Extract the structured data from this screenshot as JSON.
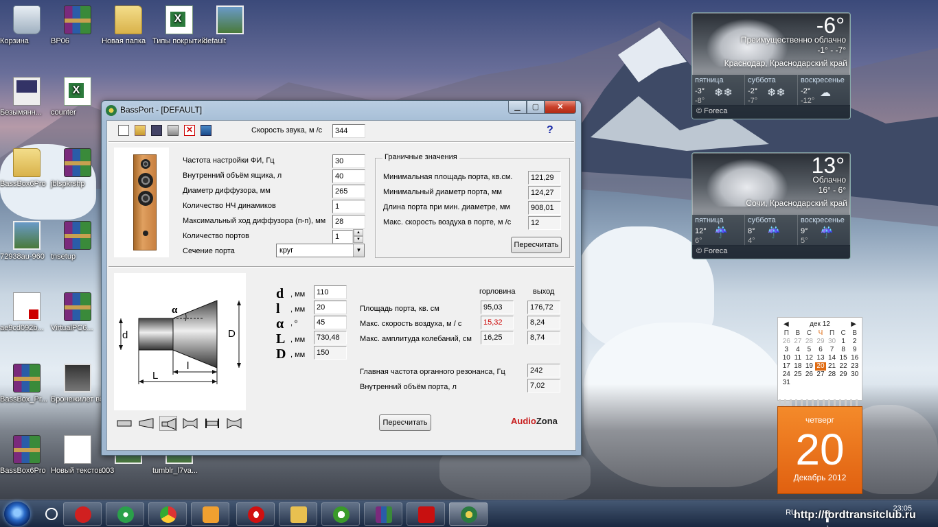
{
  "desktop": {
    "icons": [
      {
        "label": "Корзина",
        "icon": "recycle-bin-icon"
      },
      {
        "label": "BP06",
        "icon": "winrar-archive-icon"
      },
      {
        "label": "Новая папка",
        "icon": "folder-icon"
      },
      {
        "label": "Типы покрытий",
        "icon": "excel-file-icon"
      },
      {
        "label": "default",
        "icon": "image-file-icon"
      },
      {
        "label": "Безымянн...",
        "icon": "paint-image-icon"
      },
      {
        "label": "counter",
        "icon": "excel-file-icon"
      },
      {
        "label": "BassBox6Pro",
        "icon": "folder-icon"
      },
      {
        "label": "jblspkrshp",
        "icon": "winrar-archive-icon"
      },
      {
        "label": "72938au-960",
        "icon": "image-file-icon"
      },
      {
        "label": "tnsetup",
        "icon": "winrar-archive-icon"
      },
      {
        "label": "ae9cd092b...",
        "icon": "pdf-file-icon"
      },
      {
        "label": "VirtualPC6...",
        "icon": "winrar-archive-icon"
      },
      {
        "label": "BassBox_Pr...",
        "icon": "winrar-archive-icon"
      },
      {
        "label": "Бронежилет водителя 8...",
        "icon": "video-file-icon"
      },
      {
        "label": "BassBox6Pro",
        "icon": "winrar-archive-icon"
      },
      {
        "label": "Новый текстов...",
        "icon": "text-file-icon"
      },
      {
        "label": "003",
        "icon": "image-file-icon"
      },
      {
        "label": "tumblr_l7va...",
        "icon": "image-file-icon"
      }
    ]
  },
  "weather1": {
    "temp": "-6°",
    "desc": "Преимущественно облачно",
    "range": "-1° - -7°",
    "city": "Краснодар, Краснодарский край",
    "days": [
      {
        "name": "пятница",
        "hi": "-3°",
        "lo": "-8°"
      },
      {
        "name": "суббота",
        "hi": "-2°",
        "lo": "-7°"
      },
      {
        "name": "воскресенье",
        "hi": "-2°",
        "lo": "-12°"
      }
    ],
    "provider": "© Foreca"
  },
  "weather2": {
    "temp": "13°",
    "desc": "Облачно",
    "range": "16° - 6°",
    "city": "Сочи, Краснодарский край",
    "days": [
      {
        "name": "пятница",
        "hi": "12°",
        "lo": "6°"
      },
      {
        "name": "суббота",
        "hi": "8°",
        "lo": "4°"
      },
      {
        "name": "воскресенье",
        "hi": "9°",
        "lo": "5°"
      }
    ],
    "provider": "© Foreca"
  },
  "calendar": {
    "month": "дек 12",
    "weekdays": [
      "П",
      "В",
      "С",
      "Ч",
      "П",
      "С",
      "В"
    ],
    "rows": [
      [
        "26",
        "27",
        "28",
        "29",
        "30",
        "1",
        "2"
      ],
      [
        "3",
        "4",
        "5",
        "6",
        "7",
        "8",
        "9"
      ],
      [
        "10",
        "11",
        "12",
        "13",
        "14",
        "15",
        "16"
      ],
      [
        "17",
        "18",
        "19",
        "20",
        "21",
        "22",
        "23"
      ],
      [
        "24",
        "25",
        "26",
        "27",
        "28",
        "29",
        "30"
      ],
      [
        "31",
        "",
        "",
        "",
        "",
        "",
        ""
      ]
    ],
    "day_of_week": "четверг",
    "day": "20",
    "month_year": "Декабрь 2012"
  },
  "window": {
    "title": "BassPort - [DEFAULT]",
    "speed_label": "Скорость звука, м /с",
    "speed_value": "344",
    "help": "?",
    "params": [
      {
        "label": "Частота настройки ФИ, Гц",
        "value": "30"
      },
      {
        "label": "Внутренний объём ящика, л",
        "value": "40"
      },
      {
        "label": "Диаметр диффузора, мм",
        "value": "265"
      },
      {
        "label": "Количество НЧ динамиков",
        "value": "1"
      },
      {
        "label": "Максимальный ход диффузора (п-п), мм",
        "value": "28"
      },
      {
        "label": "Количество портов",
        "value": "1"
      }
    ],
    "section_label": "Сечение порта",
    "section_value": "круг",
    "limits": {
      "title": "Граничные значения",
      "rows": [
        {
          "label": "Минимальная площадь порта, кв.см.",
          "value": "121,29"
        },
        {
          "label": "Минимальный диаметр порта, мм",
          "value": "124,27"
        },
        {
          "label": "Длина порта при мин. диаметре, мм",
          "value": "908,01"
        },
        {
          "label": "Макс. скорость воздуха в порте, м /с",
          "value": "12"
        }
      ],
      "button": "Пересчитать"
    },
    "dims": [
      {
        "sym": "d",
        "unit": ", мм",
        "value": "110"
      },
      {
        "sym": "l",
        "unit": ", мм",
        "value": "20"
      },
      {
        "sym": "α",
        "unit": ", º",
        "value": "45"
      },
      {
        "sym": "L",
        "unit": ", мм",
        "value": "730,48"
      },
      {
        "sym": "D",
        "unit": ", мм",
        "value": "150"
      }
    ],
    "results": {
      "col_throat": "горловина",
      "col_exit": "выход",
      "rows": [
        {
          "label": "Площадь порта, кв. см",
          "throat": "95,03",
          "exit": "176,72"
        },
        {
          "label": "Макс. скорость воздуха, м / с",
          "throat": "15,32",
          "exit": "8,24"
        },
        {
          "label": "Макс. амплитуда колебаний, см",
          "throat": "16,25",
          "exit": "8,74"
        }
      ],
      "organ_label": "Главная частота органного резонанса, Гц",
      "organ_value": "242",
      "volume_label": "Внутренний объём порта, л",
      "volume_value": "7,02"
    },
    "diagram_labels": {
      "alpha": "α",
      "d": "d",
      "D": "D",
      "L": "L",
      "l": "l"
    },
    "recalc_button": "Пересчитать",
    "logo_a": "Audio",
    "logo_b": "Zona"
  },
  "taskbar": {
    "lang": "RU",
    "time": "23:05",
    "watermark": "http://fordtransitclub.ru"
  }
}
